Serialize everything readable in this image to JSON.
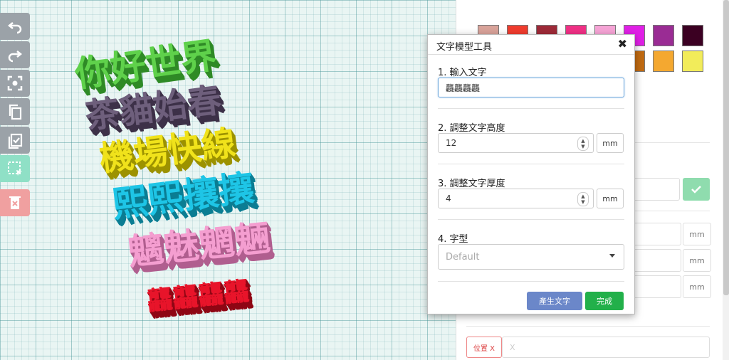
{
  "toolbar": {
    "tools": [
      {
        "name": "undo",
        "icon": "undo-icon"
      },
      {
        "name": "redo",
        "icon": "redo-icon"
      },
      {
        "name": "focus",
        "icon": "focus-icon"
      },
      {
        "name": "copy",
        "icon": "copy-icon"
      },
      {
        "name": "select-all",
        "icon": "checklist-icon"
      },
      {
        "name": "multi-select",
        "icon": "select-box-icon"
      },
      {
        "name": "delete",
        "icon": "delete-icon"
      }
    ]
  },
  "scene": {
    "words": [
      {
        "text": "你好世界",
        "color": "#5fd14b",
        "shadow": "#2f8a26"
      },
      {
        "text": "茶貓始春",
        "color": "#6e5f7c",
        "shadow": "#3d3148"
      },
      {
        "text": "機場快線",
        "color": "#f0e21b",
        "shadow": "#9c9200"
      },
      {
        "text": "熙熙攘攘",
        "color": "#1ec5e6",
        "shadow": "#0b7d93"
      },
      {
        "text": "魑魅魍魎",
        "color": "#f49ed0",
        "shadow": "#b05e8f"
      },
      {
        "text": "龘龘龘龘",
        "color": "#e8142a",
        "shadow": "#8f0614"
      }
    ]
  },
  "palette": {
    "colors": [
      "#d9a39a",
      "#f03c2e",
      "#9e2a38",
      "#f03086",
      "#f6a4d6",
      "#e020e6",
      "#9a2c94",
      "#3b0022",
      "#00145a",
      "#2a7a2a",
      "#0f3d1a",
      "#000000",
      "#4a4a58",
      "#c06a12",
      "#f4a830",
      "#f2ec5a"
    ]
  },
  "sidepanel": {
    "mm_label": "mm",
    "position_x_label": "位置 X",
    "position_x_value": "X"
  },
  "dialog": {
    "title": "文字模型工具",
    "close_icon": "✖",
    "text_label": "1. 輸入文字",
    "text_value": "龘龘龘龘",
    "height_label": "2. 調整文字高度",
    "height_value": "12",
    "height_unit": "mm",
    "thickness_label": "3. 調整文字厚度",
    "thickness_value": "4",
    "thickness_unit": "mm",
    "font_label": "4. 字型",
    "font_value": "Default",
    "generate_button": "產生文字",
    "done_button": "完成"
  }
}
